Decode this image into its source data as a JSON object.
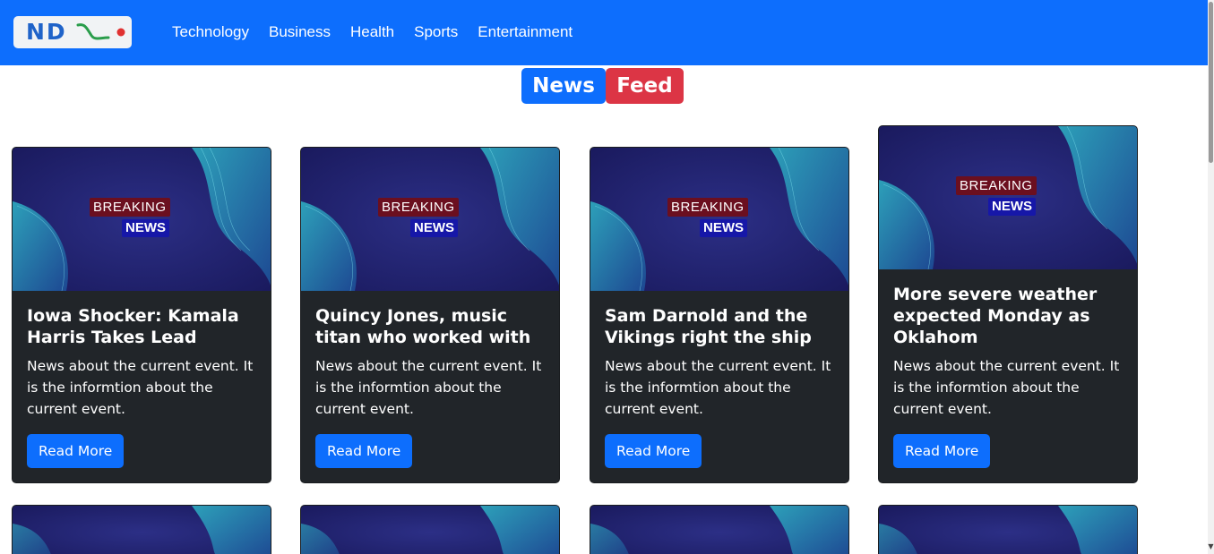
{
  "navbar": {
    "logo_text": "ND",
    "links": [
      "Technology",
      "Business",
      "Health",
      "Sports",
      "Entertainment"
    ]
  },
  "heading": {
    "part1": "News",
    "part2": "Feed"
  },
  "image_badges": {
    "breaking": "BREAKING",
    "news": "NEWS"
  },
  "cards": [
    {
      "title": "Iowa Shocker: Kamala Harris Takes Lead Where D",
      "text": "News about the current event. It is the informtion about the current event.",
      "button": "Read More"
    },
    {
      "title": "Quincy Jones, music titan who worked with ever",
      "text": "News about the current event. It is the informtion about the current event.",
      "button": "Read More"
    },
    {
      "title": "Sam Darnold and the Vikings right the ship in",
      "text": "News about the current event. It is the informtion about the current event.",
      "button": "Read More"
    },
    {
      "title": "More severe weather expected Monday as Oklahom",
      "text": "News about the current event. It is the informtion about the current event.",
      "button": "Read More"
    }
  ],
  "colors": {
    "primary": "#0d6efd",
    "danger": "#dc3545",
    "card_bg": "#212529"
  }
}
